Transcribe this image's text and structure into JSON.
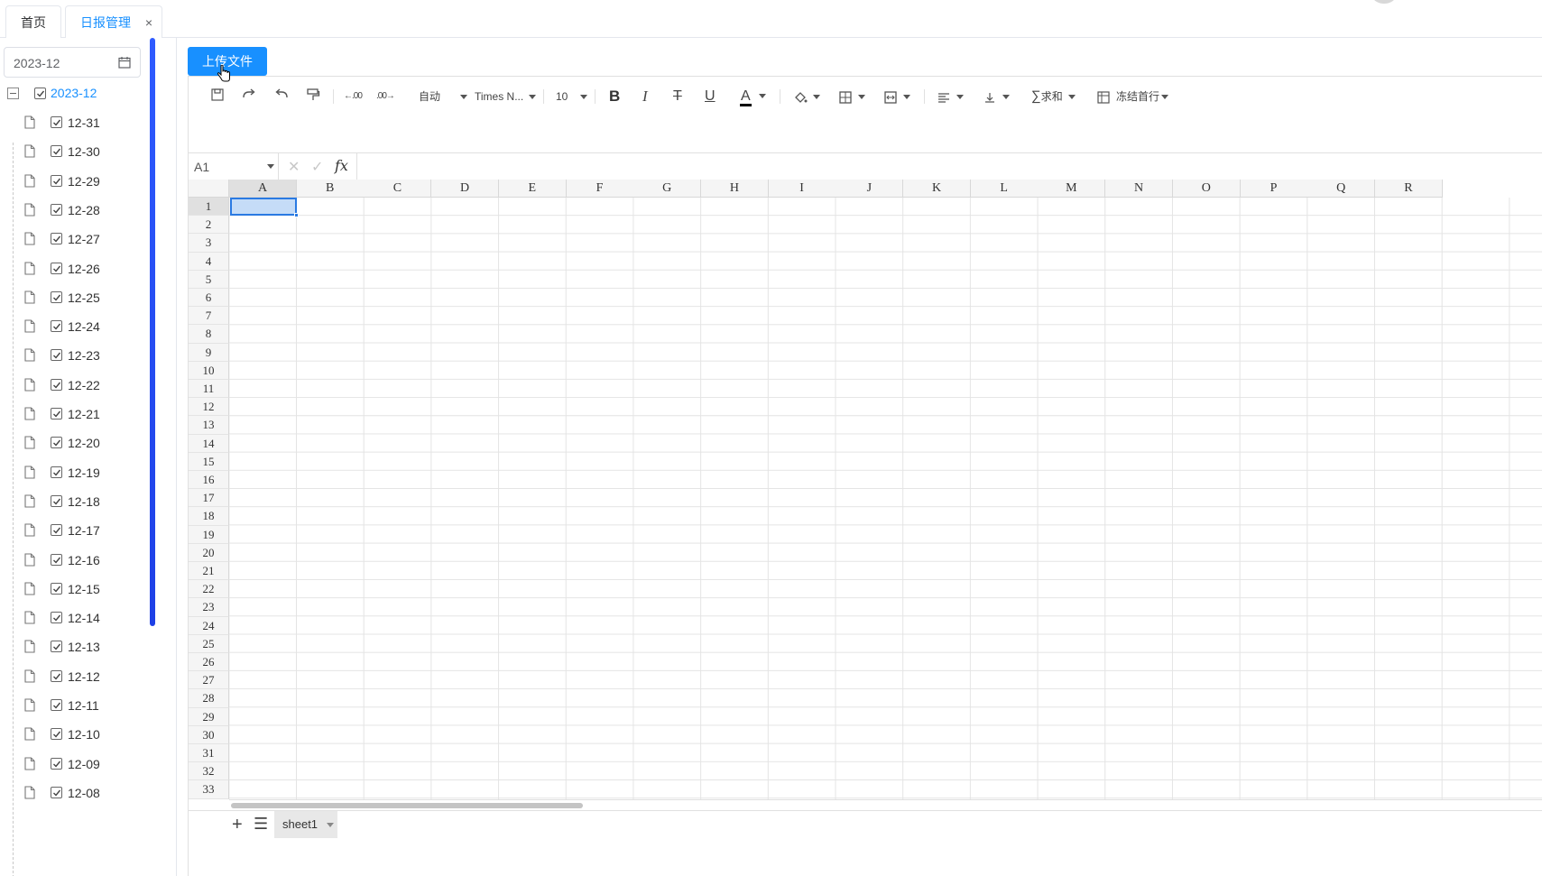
{
  "tabs": [
    {
      "label": "首页"
    },
    {
      "label": "日报管理",
      "close": "×"
    }
  ],
  "sidebar": {
    "date_value": "2023-12",
    "root_label": "2023-12",
    "items": [
      "12-31",
      "12-30",
      "12-29",
      "12-28",
      "12-27",
      "12-26",
      "12-25",
      "12-24",
      "12-23",
      "12-22",
      "12-21",
      "12-20",
      "12-19",
      "12-18",
      "12-17",
      "12-16",
      "12-15",
      "12-14",
      "12-13",
      "12-12",
      "12-11",
      "12-10",
      "12-09",
      "12-08"
    ]
  },
  "main": {
    "upload_label": "上传文件"
  },
  "toolbar": {
    "format_label": "自动",
    "font_name": "Times N...",
    "font_size": "10",
    "sum_label": "求和",
    "freeze_label": "冻结首行"
  },
  "formula_bar": {
    "cell_ref": "A1",
    "fx": "fx"
  },
  "grid": {
    "columns": [
      "A",
      "B",
      "C",
      "D",
      "E",
      "F",
      "G",
      "H",
      "I",
      "J",
      "K",
      "L",
      "M",
      "N",
      "O",
      "P",
      "Q",
      "R"
    ],
    "rows": [
      "1",
      "2",
      "3",
      "4",
      "5",
      "6",
      "7",
      "8",
      "9",
      "10",
      "11",
      "12",
      "13",
      "14",
      "15",
      "16",
      "17",
      "18",
      "19",
      "20",
      "21",
      "22",
      "23",
      "24",
      "25",
      "26",
      "27",
      "28",
      "29",
      "30",
      "31",
      "32",
      "33"
    ],
    "selected_cell": "A1"
  },
  "sheets": [
    {
      "name": "sheet1"
    }
  ],
  "colors": {
    "accent": "#1890ff",
    "selection": "#2a7ae2",
    "scrollbar": "#1e40e6"
  }
}
